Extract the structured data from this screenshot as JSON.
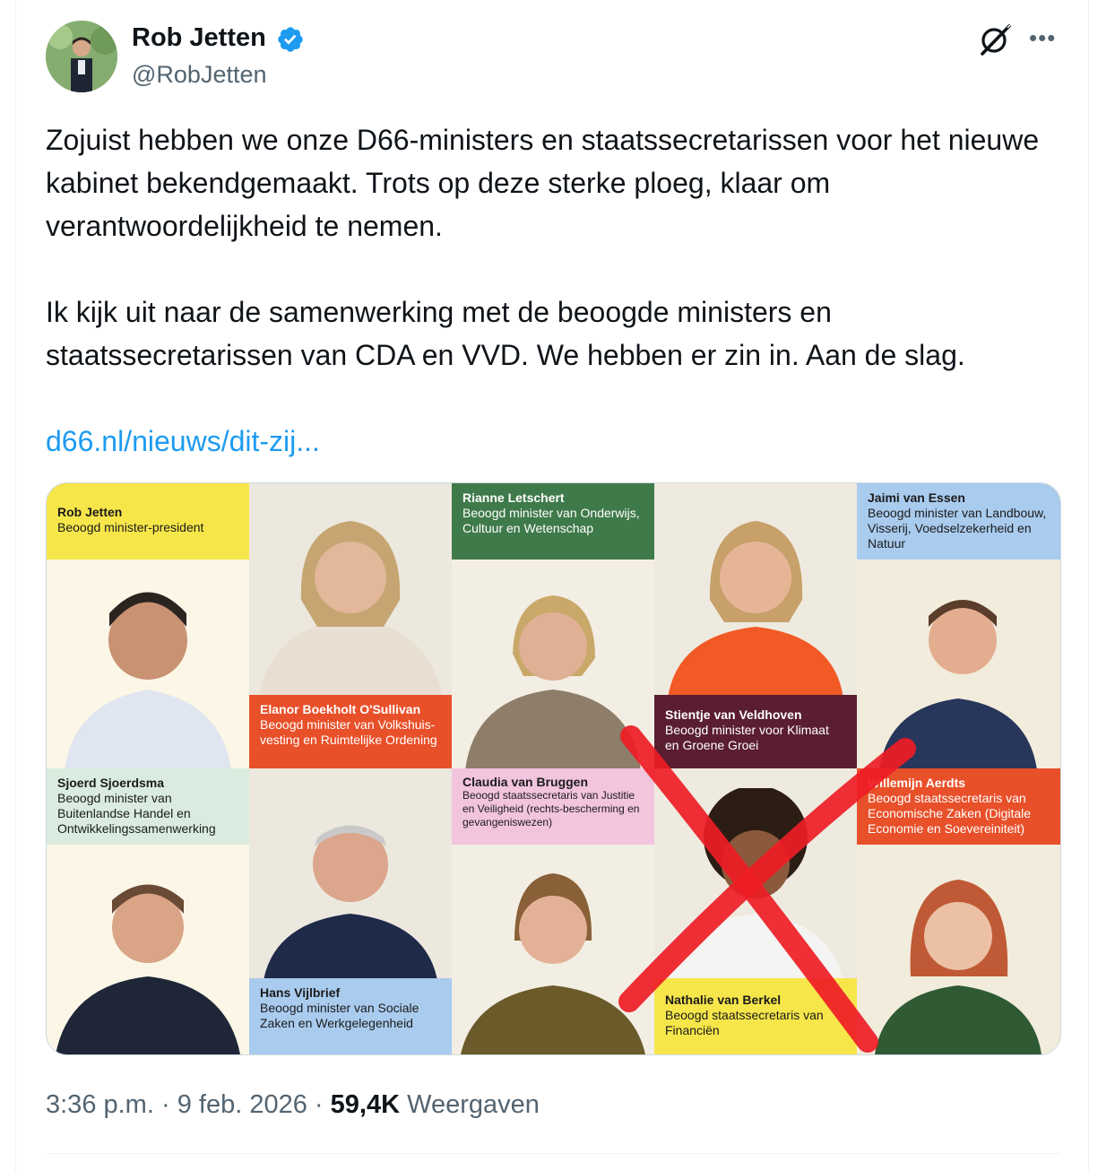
{
  "author": {
    "name": "Rob Jetten",
    "handle": "@RobJetten",
    "verified": true
  },
  "tweet": {
    "paragraph1": "Zojuist hebben we onze D66-ministers en staatssecretarissen voor het nieuwe kabinet bekendgemaakt. Trots op deze sterke ploeg, klaar om verantwoordelijkheid te nemen.",
    "paragraph2": "Ik kijk uit naar de samenwerking met de beoogde ministers en staatssecretarissen van CDA en VVD. We hebben er zin in. Aan de slag.",
    "link": "d66.nl/nieuws/dit-zij..."
  },
  "media": {
    "labels": [
      {
        "name": "Rob Jetten",
        "role": "Beoogd minister-president",
        "color": "#f7e64a"
      },
      {
        "name": "Elanor Boekholt O'Sullivan",
        "role": "Beoogd minister van Volkshuis-vesting en Ruimtelijke Ordening",
        "color": "#e8502a"
      },
      {
        "name": "Rianne Letschert",
        "role": "Beoogd minister van Onderwijs, Cultuur en Wetenschap",
        "color": "#3f7a4a"
      },
      {
        "name": "Stientje van Veldhoven",
        "role": "Beoogd minister voor Klimaat en Groene Groei",
        "color": "#5a1e30"
      },
      {
        "name": "Jaimi van Essen",
        "role": "Beoogd minister van Landbouw, Visserij, Voedselzekerheid en Natuur",
        "color": "#a9cbee"
      },
      {
        "name": "Sjoerd Sjoerdsma",
        "role": "Beoogd minister van Buitenlandse Handel en Ontwikkelingssamenwerking",
        "color": "#d9ecdf"
      },
      {
        "name": "Hans Vijlbrief",
        "role": "Beoogd minister van Sociale Zaken en Werkgelegenheid",
        "color": "#a9cbee"
      },
      {
        "name": "Claudia van Bruggen",
        "role": "Beoogd staatssecretaris van Justitie en Veiligheid (rechts-bescherming en gevangeniswezen)",
        "color": "#f2c4de"
      },
      {
        "name": "Nathalie van Berkel",
        "role": "Beoogd staatssecretaris van Financiën",
        "color": "#f7e64a"
      },
      {
        "name": "Willemijn Aerdts",
        "role": "Beoogd staatssecretaris van Economische Zaken (Digitale Economie en Soevereiniteit)",
        "color": "#e8502a"
      }
    ],
    "cross_color": "#ee1c25"
  },
  "meta": {
    "time": "3:36 p.m.",
    "separator": "·",
    "date": "9 feb. 2026",
    "views_count": "59,4K",
    "views_label": "Weergaven"
  },
  "icons": {
    "verified": "verified-badge-icon",
    "grok": "grok-icon",
    "more": "more-icon"
  }
}
